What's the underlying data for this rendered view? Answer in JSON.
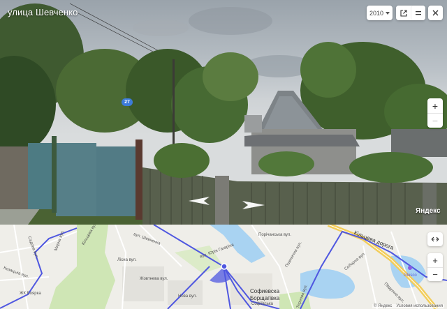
{
  "panorama": {
    "street_title": "улица Шевченко",
    "year": "2010",
    "house_number": "27",
    "watermark": "Яндекс",
    "zoom_in": "+",
    "zoom_out": "−"
  },
  "map": {
    "zoom_in": "+",
    "zoom_out": "−",
    "labels": {
      "kulineva": "Кільцева дорога",
      "sofiivska": "Софиевска",
      "borshchagivka": "Борщагівка",
      "sofiivska_lower": "Софіївська",
      "zhk": "ЖК Боярка",
      "glusco": "Glusco",
      "kozatska": "Козацька вул.",
      "shevchenka": "вул. Шевченка",
      "yurii": "вул. Юрія Гагаріна",
      "lisna": "Лісна вул.",
      "porcheska": "Порічанська вул.",
      "kolcova": "Кільцева вул.",
      "sadova": "Садова вул.",
      "pshenychna": "Пшенична вул.",
      "soborna": "Соборна вул.",
      "pivdenna": "Південна вул.",
      "ternova": "Тернова вул.",
      "mirna": "Мирна вул.",
      "zhovtneva": "Жовтнева вул.",
      "nova": "Нова вул."
    },
    "footer_brand": "© Яндекс",
    "footer_terms": "Условия использования"
  },
  "colors": {
    "route": "#4f57e0",
    "water": "#a9d3f2",
    "park": "#cfe6b5",
    "badge": "#3d7bd9"
  }
}
